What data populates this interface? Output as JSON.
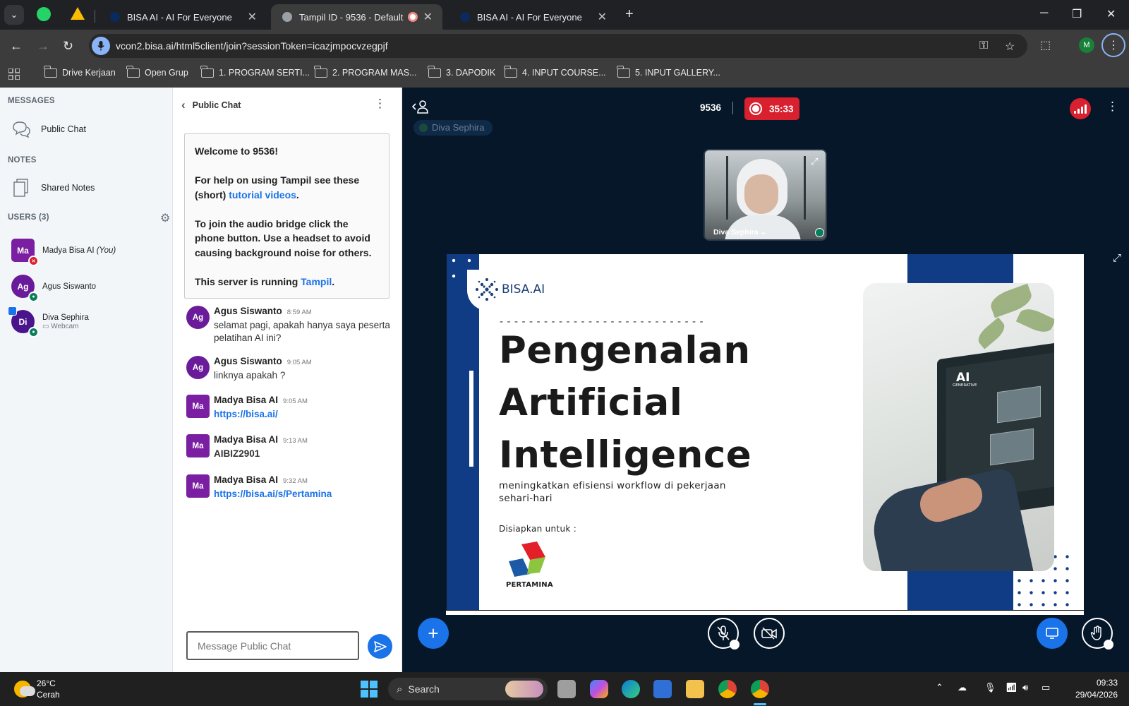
{
  "browser": {
    "tabs": [
      {
        "label": "BISA AI - AI For Everyone",
        "active": false
      },
      {
        "label": "Tampil ID - 9536 - Default p",
        "active": true
      },
      {
        "label": "BISA AI - AI For Everyone",
        "active": false
      }
    ],
    "url": "vcon2.bisa.ai/html5client/join?sessionToken=icazjmpocvzegpjf",
    "profile_initial": "M",
    "bookmarks": [
      {
        "label": "Drive Kerjaan",
        "icon": "folder-icon"
      },
      {
        "label": "Open Grup",
        "icon": "folder-icon"
      },
      {
        "label": "1. PROGRAM SERTI...",
        "icon": "folder-icon"
      },
      {
        "label": "2. PROGRAM MAS...",
        "icon": "folder-icon"
      },
      {
        "label": "3. DAPODIK",
        "icon": "folder-icon"
      },
      {
        "label": "4. INPUT COURSE...",
        "icon": "folder-icon"
      },
      {
        "label": "5. INPUT GALLERY...",
        "icon": "folder-icon"
      }
    ]
  },
  "userpanel": {
    "messages_title": "MESSAGES",
    "public_chat_label": "Public Chat",
    "notes_title": "NOTES",
    "shared_notes_label": "Shared Notes",
    "users_title": "USERS (3)",
    "users": [
      {
        "initials": "Ma",
        "name": "Madya Bisa AI",
        "suffix": "(You)",
        "sub": "",
        "color": "#7b1fa2"
      },
      {
        "initials": "Ag",
        "name": "Agus Siswanto",
        "suffix": "",
        "sub": "",
        "color": "#6a1b9a"
      },
      {
        "initials": "Di",
        "name": "Diva Sephira",
        "suffix": "",
        "sub": "Webcam",
        "color": "#4a148c"
      }
    ]
  },
  "chat": {
    "header": "Public Chat",
    "welcome": {
      "line1": "Welcome to 9536!",
      "help_prefix": "For help on using Tampil see these (short) ",
      "help_link": "tutorial videos",
      "help_suffix": ".",
      "audio": "To join the audio bridge click the phone button. Use a headset to avoid causing background noise for others.",
      "server_prefix": "This server is running ",
      "server_link": "Tampil",
      "server_suffix": "."
    },
    "messages": [
      {
        "initials": "Ag",
        "name": "Agus Siswanto",
        "time": "8:59 AM",
        "text": "selamat pagi, apakah hanya saya peserta pelatihan AI ini?"
      },
      {
        "initials": "Ag",
        "name": "Agus Siswanto",
        "time": "9:05 AM",
        "text": "linknya apakah ?"
      },
      {
        "initials": "Ma",
        "name": "Madya Bisa AI",
        "time": "9:05 AM",
        "text": "https://bisa.ai/"
      },
      {
        "initials": "Ma",
        "name": "Madya Bisa AI",
        "time": "9:13 AM",
        "text": "AIBIZ2901"
      },
      {
        "initials": "Ma",
        "name": "Madya Bisa AI",
        "time": "9:32 AM",
        "text": "https://bisa.ai/s/Pertamina"
      }
    ],
    "input_placeholder": "Message Public Chat"
  },
  "meeting": {
    "talking": "Diva Sephira",
    "room_id": "9536",
    "recording_time": "35:33",
    "webcam_name": "Diva Sephira ⌄",
    "colors": {
      "background": "#06172a",
      "record": "#d9202f",
      "accent": "#1a73e8"
    }
  },
  "slide": {
    "logo_text": "BISA.AI",
    "dash_line": "- - - - - - - - - - - - - - - - - - - - - - - - - - - -",
    "title_lines": [
      "Pengenalan",
      "Artificial",
      "Intelligence"
    ],
    "subtitle": "meningkatkan efisiensi workflow di pekerjaan sehari-hari",
    "prepared_for": "Disiapkan untuk :",
    "client": "PERTAMINA",
    "photo_ai": "AI",
    "photo_ai_sub": "GENERATIVE"
  },
  "taskbar": {
    "temperature": "26°C",
    "weather": "Cerah",
    "search_label": "Search",
    "time": "09:33",
    "date": "29/04/2026"
  }
}
